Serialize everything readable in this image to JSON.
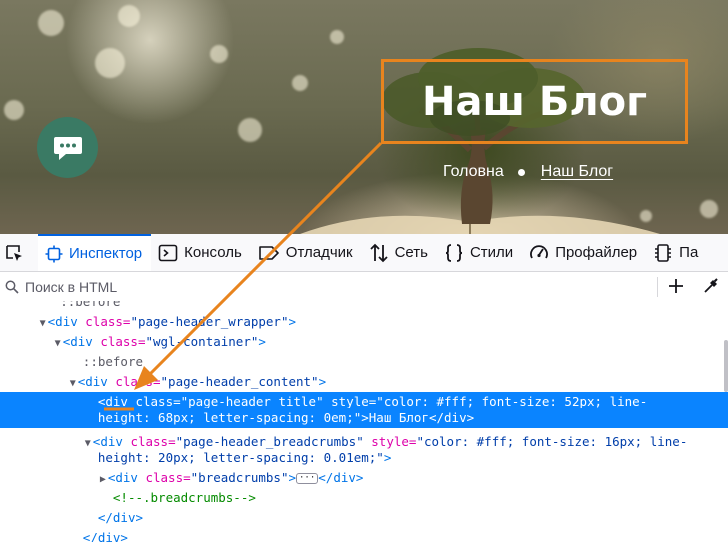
{
  "hero": {
    "title": "Наш Блог",
    "breadcrumbs": {
      "home": "Головна",
      "current": "Наш Блог"
    },
    "chat_icon": "chat-bubble-icon",
    "highlight_color": "#e8841e"
  },
  "devtools": {
    "tabs": [
      {
        "label": "Инспектор",
        "icon": "inspector-icon",
        "active": true
      },
      {
        "label": "Консоль",
        "icon": "console-icon"
      },
      {
        "label": "Отладчик",
        "icon": "debugger-icon"
      },
      {
        "label": "Сеть",
        "icon": "network-icon"
      },
      {
        "label": "Стили",
        "icon": "style-editor-icon"
      },
      {
        "label": "Профайлер",
        "icon": "profiler-icon"
      },
      {
        "label": "Па",
        "icon": "memory-icon"
      }
    ],
    "search_placeholder": "Поиск в HTML",
    "accent": "#0061e0",
    "selection_color": "#0a84ff"
  },
  "markup": {
    "r0": "::before",
    "r1_tag_open": "<div ",
    "r1_attr": "class=",
    "r1_val": "\"page-header_wrapper\"",
    "r1_close": ">",
    "r2_tag_open": "<div ",
    "r2_attr": "class=",
    "r2_val": "\"wgl-container\"",
    "r2_close": ">",
    "r3": "::before",
    "r4_tag_open": "<div ",
    "r4_attr": "class=",
    "r4_val": "\"page-header_content\"",
    "r4_close": ">",
    "r5": "<div class=\"page-header_title\" style=\"color: #fff; font-size: 52px; line-",
    "r6": "height: 68px; letter-spacing: 0em;\">Наш Блог</div>",
    "r7_tag_open": "<div ",
    "r7_attr": "class=",
    "r7_val": "\"page-header_breadcrumbs\"",
    "r7_attr2": " style=",
    "r7_val2": "\"color: #fff; font-size: 16px; line-",
    "r8_val": "height: 20px; letter-spacing: 0.01em;\"",
    "r8_close": ">",
    "r9_tag_open": "<div ",
    "r9_attr": "class=",
    "r9_val": "\"breadcrumbs\"",
    "r9_close": ">",
    "r9_ellipsis": "···",
    "r9_end": "</div>",
    "r10": "<!--.breadcrumbs-->",
    "r11": "</div>",
    "r12": "</div>"
  }
}
